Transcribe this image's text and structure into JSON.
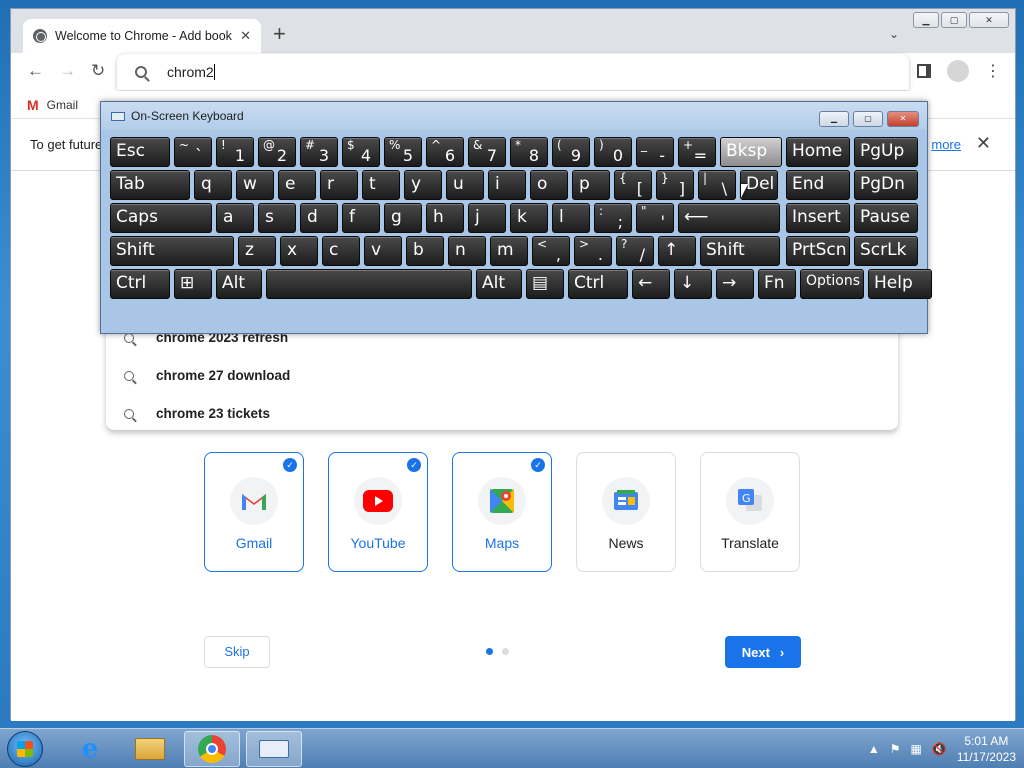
{
  "browser": {
    "tab_title": "Welcome to Chrome - Add book",
    "new_tab_label": "+",
    "omnibox_text": "chrom2",
    "bookmarks": [
      {
        "label": "Gmail"
      }
    ],
    "info_text": "To get future",
    "info_link": "more"
  },
  "suggestions": [
    {
      "text": "chrome 2023 refresh"
    },
    {
      "text": "chrome 27 download"
    },
    {
      "text": "chrome 23 tickets"
    }
  ],
  "apps": [
    {
      "label": "Gmail",
      "selected": true,
      "icon": "gmail-icon"
    },
    {
      "label": "YouTube",
      "selected": true,
      "icon": "youtube-icon"
    },
    {
      "label": "Maps",
      "selected": true,
      "icon": "maps-icon"
    },
    {
      "label": "News",
      "selected": false,
      "icon": "news-icon"
    },
    {
      "label": "Translate",
      "selected": false,
      "icon": "translate-icon"
    }
  ],
  "actions": {
    "skip_label": "Skip",
    "next_label": "Next",
    "page_count": 2,
    "current_page": 1
  },
  "osk": {
    "title": "On-Screen Keyboard",
    "rows": [
      [
        [
          "Esc"
        ],
        [
          "~",
          "`"
        ],
        [
          "!",
          "1"
        ],
        [
          "@",
          "2"
        ],
        [
          "#",
          "3"
        ],
        [
          "$",
          "4"
        ],
        [
          "%",
          "5"
        ],
        [
          "^",
          "6"
        ],
        [
          "&",
          "7"
        ],
        [
          "*",
          "8"
        ],
        [
          "(",
          "9"
        ],
        [
          ")",
          "0"
        ],
        [
          "_",
          "-"
        ],
        [
          "+",
          "="
        ],
        [
          "Bksp"
        ],
        [
          "Home"
        ],
        [
          "PgUp"
        ]
      ],
      [
        [
          "Tab"
        ],
        [
          "q"
        ],
        [
          "w"
        ],
        [
          "e"
        ],
        [
          "r"
        ],
        [
          "t"
        ],
        [
          "y"
        ],
        [
          "u"
        ],
        [
          "i"
        ],
        [
          "o"
        ],
        [
          "p"
        ],
        [
          "{",
          "["
        ],
        [
          "}",
          "]"
        ],
        [
          "|",
          "\\"
        ],
        [
          "Del"
        ],
        [
          "End"
        ],
        [
          "PgDn"
        ]
      ],
      [
        [
          "Caps"
        ],
        [
          "a"
        ],
        [
          "s"
        ],
        [
          "d"
        ],
        [
          "f"
        ],
        [
          "g"
        ],
        [
          "h"
        ],
        [
          "j"
        ],
        [
          "k"
        ],
        [
          "l"
        ],
        [
          ":",
          ";"
        ],
        [
          "\"",
          "'"
        ],
        [
          "⟵"
        ],
        [
          "Insert"
        ],
        [
          "Pause"
        ]
      ],
      [
        [
          "Shift"
        ],
        [
          "z"
        ],
        [
          "x"
        ],
        [
          "c"
        ],
        [
          "v"
        ],
        [
          "b"
        ],
        [
          "n"
        ],
        [
          "m"
        ],
        [
          "<",
          ","
        ],
        [
          ">",
          "."
        ],
        [
          "?",
          "/"
        ],
        [
          "↑"
        ],
        [
          "Shift"
        ],
        [
          "PrtScn"
        ],
        [
          "ScrLk"
        ]
      ],
      [
        [
          "Ctrl"
        ],
        [
          "⊞"
        ],
        [
          "Alt"
        ],
        [
          ""
        ],
        [
          "Alt"
        ],
        [
          "▤"
        ],
        [
          "Ctrl"
        ],
        [
          "←"
        ],
        [
          "↓"
        ],
        [
          "→"
        ],
        [
          "Fn"
        ],
        [
          "Options"
        ],
        [
          "Help"
        ]
      ]
    ]
  },
  "taskbar": {
    "time": "5:01 AM",
    "date": "11/17/2023",
    "items": [
      "ie-icon",
      "explorer-icon",
      "chrome-icon",
      "osk-icon"
    ]
  },
  "colors": {
    "accent": "#1a73e8",
    "osk_bg": "#a9c6e6"
  }
}
